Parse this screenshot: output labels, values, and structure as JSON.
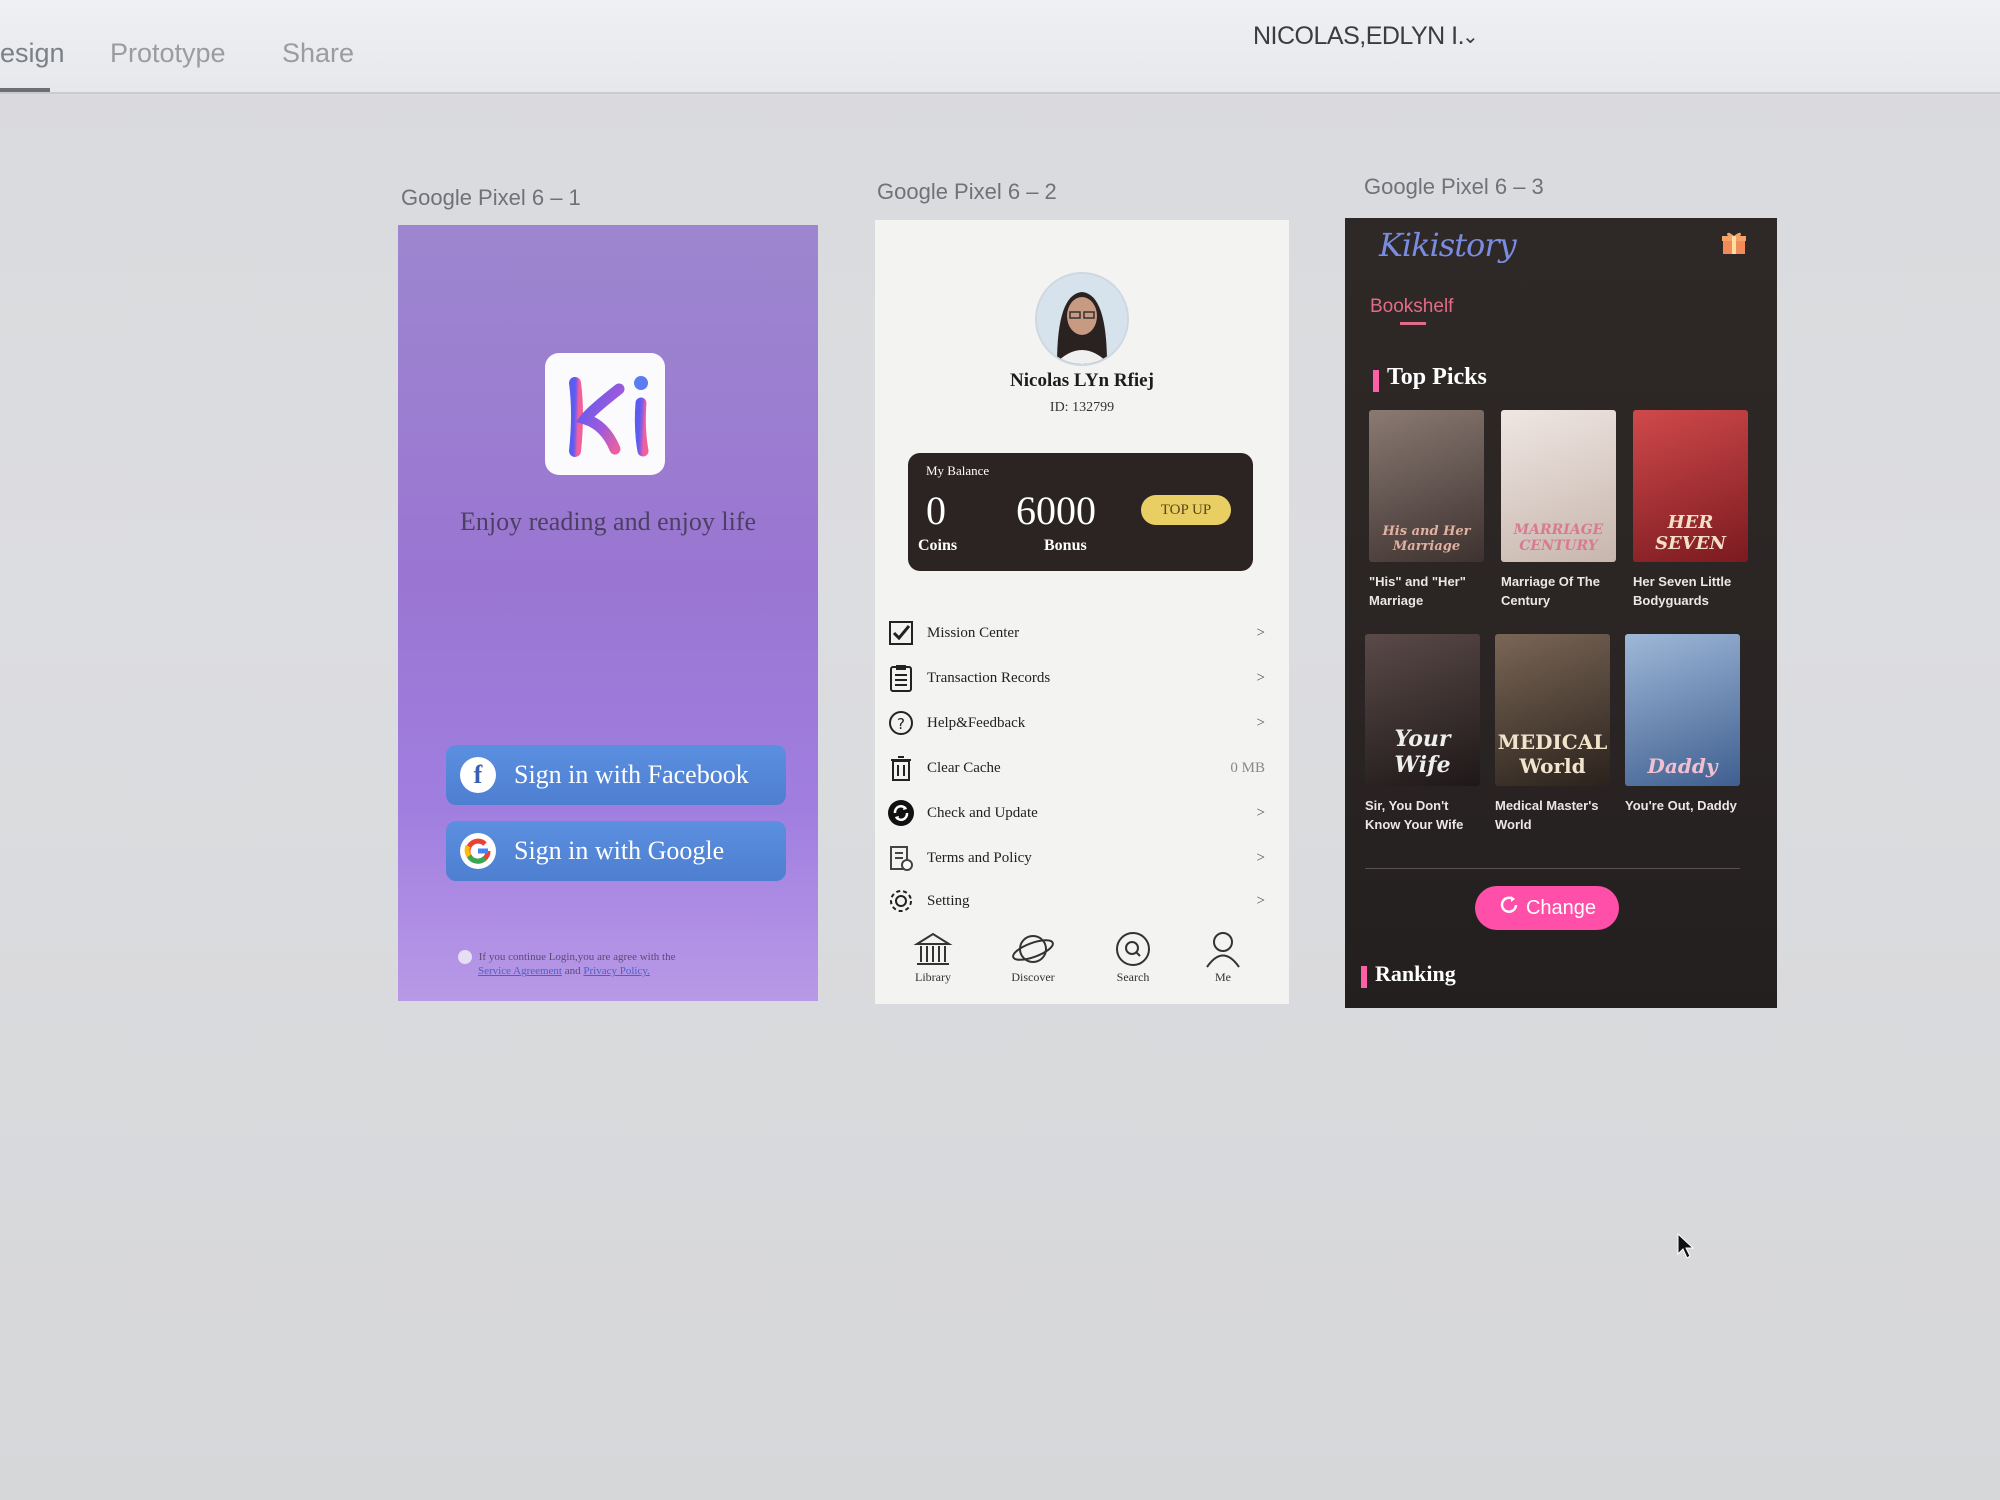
{
  "topbar": {
    "tabs": [
      {
        "label": "esign"
      },
      {
        "label": "Prototype"
      },
      {
        "label": "Share"
      }
    ],
    "user_name": "NICOLAS,EDLYN I."
  },
  "artboards": [
    {
      "title": "Google Pixel 6 – 1"
    },
    {
      "title": "Google Pixel 6 – 2"
    },
    {
      "title": "Google Pixel 6 – 3"
    }
  ],
  "login": {
    "logo_text": "Ki",
    "tagline": "Enjoy reading and enjoy life",
    "facebook_label": "Sign in with Facebook",
    "google_label": "Sign in with Google",
    "consent_text": "If you continue Login,you are agree with the",
    "consent_link1": "Service Agreement",
    "consent_and": "and",
    "consent_link2": "Privacy Policy."
  },
  "profile": {
    "name": "Nicolas LYn Rfiej",
    "id": "ID: 132799",
    "balance_title": "My Balance",
    "coins_value": "0",
    "coins_label": "Coins",
    "bonus_value": "6000",
    "bonus_label": "Bonus",
    "topup_label": "TOP UP",
    "menu": [
      {
        "label": "Mission Center",
        "right": ">",
        "icon": "checkbox-icon"
      },
      {
        "label": "Transaction Records",
        "right": ">",
        "icon": "clipboard-icon"
      },
      {
        "label": "Help&Feedback",
        "right": ">",
        "icon": "question-icon"
      },
      {
        "label": "Clear Cache",
        "right": "0 MB",
        "icon": "trash-icon"
      },
      {
        "label": "Check and Update",
        "right": ">",
        "icon": "refresh-icon"
      },
      {
        "label": "Terms and Policy",
        "right": ">",
        "icon": "policy-icon"
      },
      {
        "label": "Setting",
        "right": ">",
        "icon": "gear-icon"
      }
    ],
    "nav": [
      {
        "label": "Library"
      },
      {
        "label": "Discover"
      },
      {
        "label": "Search"
      },
      {
        "label": "Me"
      }
    ]
  },
  "bookshelf": {
    "brand": "Kikistory",
    "tab": "Bookshelf",
    "top_picks_title": "Top Picks",
    "books": [
      {
        "title": "\"His\" and \"Her\" Marriage",
        "cover_text": "His and Her Marriage",
        "color": "#6b5a54"
      },
      {
        "title": "Marriage Of The Century",
        "cover_text": "MARRIAGE CENTURY",
        "color": "#d9cdc8"
      },
      {
        "title": "Her Seven Little Bodyguards",
        "cover_text": "HER SEVEN",
        "color": "#a8292d"
      },
      {
        "title": "Sir, You Don't Know Your Wife",
        "cover_text": "Your Wife",
        "color": "#3a2f30"
      },
      {
        "title": "Medical Master's World",
        "cover_text": "MEDICAL World",
        "color": "#4a3c33"
      },
      {
        "title": "You're Out, Daddy",
        "cover_text": "Daddy",
        "color": "#5b7db0"
      }
    ],
    "change_label": "Change",
    "ranking_title": "Ranking"
  },
  "colors": {
    "accent_pink": "#ff4fa8",
    "facebook_blue": "#4e7fd0",
    "balance_dark": "#2b2422",
    "topup_gold": "#e9cf63"
  }
}
